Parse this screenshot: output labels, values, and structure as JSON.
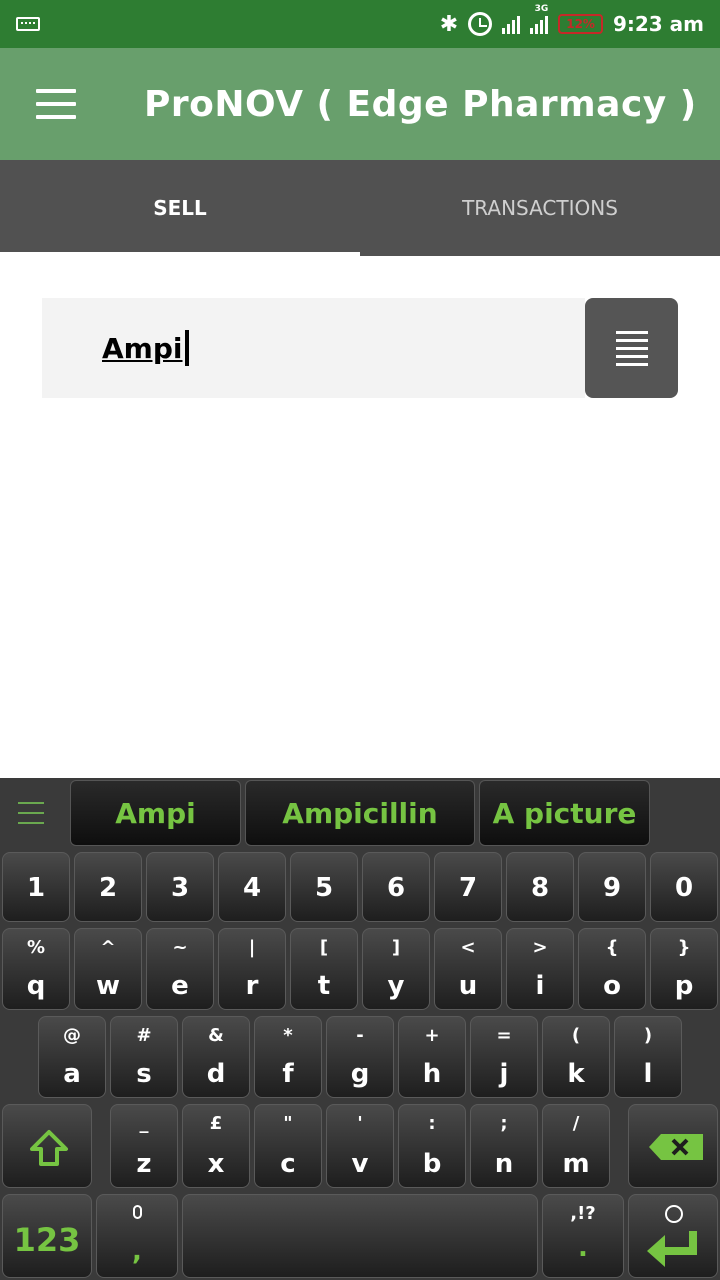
{
  "status_bar": {
    "clock": "9:23 am",
    "battery": "12%",
    "network": "3G"
  },
  "app_bar": {
    "title": "ProNOV ( Edge Pharmacy )"
  },
  "tabs": [
    {
      "label": "SELL"
    },
    {
      "label": "TRANSACTIONS"
    }
  ],
  "search": {
    "value": "Ampi"
  },
  "keyboard": {
    "suggestions": [
      "Ampi",
      "Ampicillin",
      "A picture"
    ],
    "row_numbers": [
      "1",
      "2",
      "3",
      "4",
      "5",
      "6",
      "7",
      "8",
      "9",
      "0"
    ],
    "row1": [
      {
        "sub": "%",
        "main": "q"
      },
      {
        "sub": "^",
        "main": "w"
      },
      {
        "sub": "~",
        "main": "e"
      },
      {
        "sub": "|",
        "main": "r"
      },
      {
        "sub": "[",
        "main": "t"
      },
      {
        "sub": "]",
        "main": "y"
      },
      {
        "sub": "<",
        "main": "u"
      },
      {
        "sub": ">",
        "main": "i"
      },
      {
        "sub": "{",
        "main": "o"
      },
      {
        "sub": "}",
        "main": "p"
      }
    ],
    "row2": [
      {
        "sub": "@",
        "main": "a"
      },
      {
        "sub": "#",
        "main": "s"
      },
      {
        "sub": "&",
        "main": "d"
      },
      {
        "sub": "*",
        "main": "f"
      },
      {
        "sub": "-",
        "main": "g"
      },
      {
        "sub": "+",
        "main": "h"
      },
      {
        "sub": "=",
        "main": "j"
      },
      {
        "sub": "(",
        "main": "k"
      },
      {
        "sub": ")",
        "main": "l"
      }
    ],
    "row3": [
      {
        "sub": "_",
        "main": "z"
      },
      {
        "sub": "£",
        "main": "x"
      },
      {
        "sub": "\"",
        "main": "c"
      },
      {
        "sub": "'",
        "main": "v"
      },
      {
        "sub": ":",
        "main": "b"
      },
      {
        "sub": ";",
        "main": "n"
      },
      {
        "sub": "/",
        "main": "m"
      }
    ],
    "symbols_key": "123",
    "comma_key": ",",
    "period_sub": ",!?",
    "period_key": ".",
    "accent_color": "#76c442"
  }
}
